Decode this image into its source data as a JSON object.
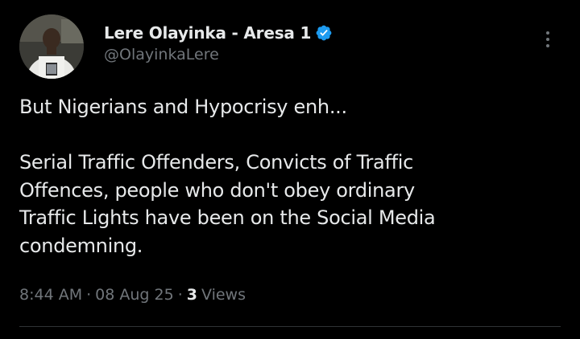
{
  "author": {
    "display_name": "Lere Olayinka - Aresa 1",
    "handle": "@OlayinkaLere",
    "verified": true,
    "verified_color": "#1d9bf0",
    "avatar_icon": "profile-photo"
  },
  "tweet": {
    "paragraphs": [
      [
        "But Nigerians and Hypocrisy enh..."
      ],
      [
        "Serial Traffic Offenders, Convicts of Traffic",
        "Offences, people who don't obey ordinary",
        "Traffic Lights have been on the Social Media",
        "condemning."
      ]
    ]
  },
  "meta": {
    "time": "8:44 AM",
    "date": "08 Aug 25",
    "separator": "·",
    "views_count": "3",
    "views_label": "Views"
  },
  "menu": {
    "icon": "more-vertical-icon"
  },
  "colors": {
    "background": "#000000",
    "text_primary": "#e7e9ea",
    "text_secondary": "#71767b",
    "divider": "#2f3336"
  }
}
